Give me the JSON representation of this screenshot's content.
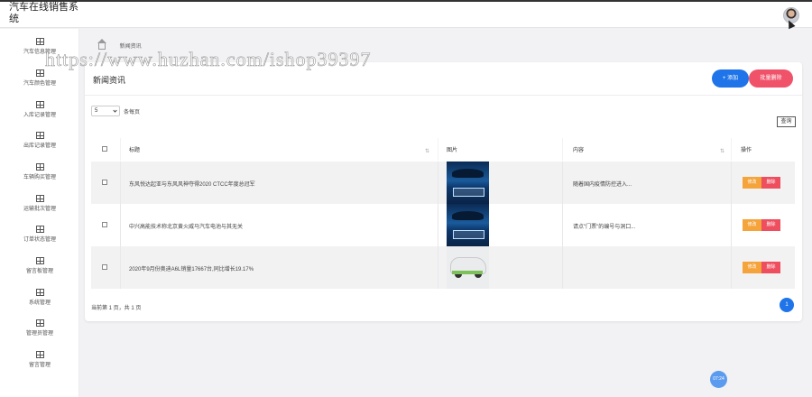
{
  "app": {
    "title": "汽车在线销售系统"
  },
  "sidebar": {
    "items": [
      {
        "label": "汽车信息管理",
        "icon": "table-icon"
      },
      {
        "label": "汽车颜色管理",
        "icon": "table-icon"
      },
      {
        "label": "入库记录管理",
        "icon": "table-icon"
      },
      {
        "label": "出库记录管理",
        "icon": "table-icon"
      },
      {
        "label": "车辆购买管理",
        "icon": "table-icon"
      },
      {
        "label": "运输批次管理",
        "icon": "table-icon"
      },
      {
        "label": "订单状态管理",
        "icon": "table-icon"
      },
      {
        "label": "留言板管理",
        "icon": "table-icon"
      },
      {
        "label": "系统管理",
        "icon": "table-icon"
      },
      {
        "label": "管理员管理",
        "icon": "table-icon"
      },
      {
        "label": "留言管理",
        "icon": "table-icon"
      }
    ]
  },
  "breadcrumb": {
    "current": "新闻资讯"
  },
  "panel": {
    "title": "新闻资讯",
    "add_label": "+ 添加",
    "batch_delete_label": "批量删除",
    "page_size_value": "5",
    "per_page_label": "条每页",
    "search_label": "查询"
  },
  "table": {
    "headers": {
      "title": "标题",
      "image": "图片",
      "content": "内容",
      "actions": "操作"
    },
    "sort_glyph": "⇅",
    "edit_label": "修改",
    "delete_label": "删除",
    "rows": [
      {
        "title": "东风悦达起亚与东风风神夺得2020 CTCC年度总冠军",
        "content": "随着国内疫情防控进入...",
        "image": "promo-banner"
      },
      {
        "title": "中兴高能技术称北京黄火威马汽车电池与其无关",
        "content": "请点\"门票\"的编号与洞口...",
        "image": "promo-banner"
      },
      {
        "title": "2020年9月份奥迪A6L销量17667台,同比增长19.17%",
        "content": "",
        "image": "white-suv"
      }
    ]
  },
  "pagination": {
    "info": "当前第 1 页，共 1 页",
    "current_page": "1"
  },
  "watermark": {
    "text": "https://www.huzhan.com/ishop39397"
  },
  "clock": {
    "time": "07:24"
  },
  "colors": {
    "primary": "#1e74e8",
    "danger": "#f0526a",
    "warning": "#f5a33b",
    "background": "#f2f2f4"
  }
}
